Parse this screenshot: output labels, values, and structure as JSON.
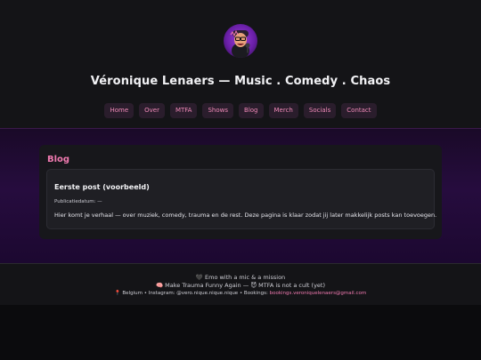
{
  "header": {
    "title": "Véronique Lenaers — Music . Comedy . Chaos",
    "nav": [
      "Home",
      "Over",
      "MTFA",
      "Shows",
      "Blog",
      "Merch",
      "Socials",
      "Contact"
    ]
  },
  "main": {
    "section_title": "Blog",
    "post": {
      "title": "Eerste post (voorbeeld)",
      "date_label": "Publicatiedatum: —",
      "body": "Hier komt je verhaal — over muziek, comedy, trauma en de rest. Deze pagina is klaar zodat jij later makkelijk posts kan toevoegen."
    }
  },
  "footer": {
    "line1_icon": "🖤",
    "line1": "Emo with a mic & a mission",
    "line2_icon": "🧠",
    "line2": "Make Trauma Funny Again —",
    "line2_icon2": "😈",
    "line2_end": "MTFA is not a cult (yet)",
    "line3_icon": "📍",
    "line3": "Belgium • Instagram: @vero.nique.nique.nique • Bookings:",
    "email": "bookings.veroniquelenaers@gmail.com"
  },
  "colors": {
    "accent": "#f07ab0",
    "nav_bg": "#2a1d2c",
    "main_bg": "#260c3e"
  }
}
